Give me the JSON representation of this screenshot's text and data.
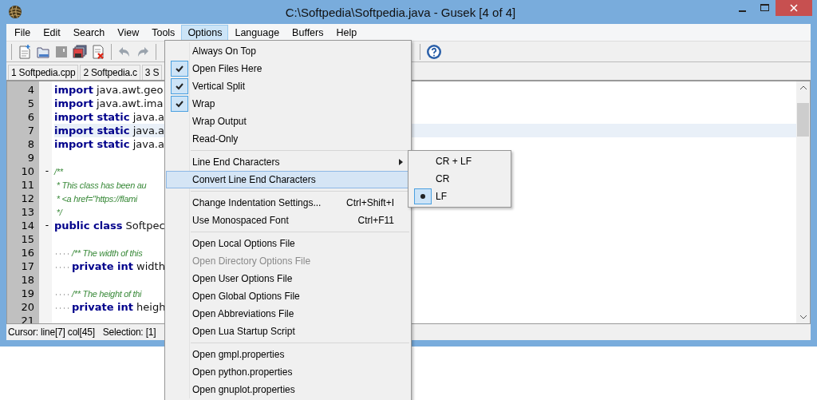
{
  "window": {
    "title": "C:\\Softpedia\\Softpedia.java - Gusek [4 of 4]"
  },
  "menubar": [
    {
      "label": "File",
      "selected": false
    },
    {
      "label": "Edit",
      "selected": false
    },
    {
      "label": "Search",
      "selected": false
    },
    {
      "label": "View",
      "selected": false
    },
    {
      "label": "Tools",
      "selected": false
    },
    {
      "label": "Options",
      "selected": true
    },
    {
      "label": "Language",
      "selected": false
    },
    {
      "label": "Buffers",
      "selected": false
    },
    {
      "label": "Help",
      "selected": false
    }
  ],
  "tabs": [
    {
      "label": "1 Softpedia.cpp",
      "selected": false
    },
    {
      "label": "2 Softpedia.c",
      "selected": false
    },
    {
      "label": "3 S",
      "selected": false
    }
  ],
  "editor": {
    "lines": [
      {
        "number": "4",
        "current": false,
        "tokens": [
          {
            "kind": "keyword",
            "text": "import"
          },
          {
            "kind": "plain",
            "text": " java.awt.geo"
          }
        ]
      },
      {
        "number": "5",
        "current": false,
        "tokens": [
          {
            "kind": "keyword",
            "text": "import"
          },
          {
            "kind": "plain",
            "text": " java.awt.ima"
          }
        ]
      },
      {
        "number": "6",
        "current": false,
        "tokens": [
          {
            "kind": "keyword",
            "text": "import static"
          },
          {
            "kind": "plain",
            "text": " java.a"
          }
        ]
      },
      {
        "number": "7",
        "current": true,
        "tokens": [
          {
            "kind": "keyword",
            "text": "import static"
          },
          {
            "kind": "plain",
            "text": " java.a"
          }
        ]
      },
      {
        "number": "8",
        "current": false,
        "tokens": [
          {
            "kind": "keyword",
            "text": "import static"
          },
          {
            "kind": "plain",
            "text": " java.a"
          }
        ]
      },
      {
        "number": "9",
        "current": false
      },
      {
        "number": "10",
        "fold": "-",
        "current": false,
        "tokens": [
          {
            "kind": "comment",
            "text": "/**"
          }
        ]
      },
      {
        "number": "11",
        "current": false,
        "tokens": [
          {
            "kind": "comment",
            "text": " * This class has been au"
          }
        ]
      },
      {
        "number": "12",
        "current": false,
        "tokens": [
          {
            "kind": "comment",
            "text": " * <a href=\"https://flami"
          }
        ]
      },
      {
        "number": "13",
        "current": false,
        "tokens": [
          {
            "kind": "comment",
            "text": " */"
          }
        ]
      },
      {
        "number": "14",
        "fold": "-",
        "current": false,
        "tokens": [
          {
            "kind": "keyword",
            "text": "public class"
          },
          {
            "kind": "plain",
            "text": " Softpec"
          }
        ]
      },
      {
        "number": "15",
        "current": false
      },
      {
        "number": "16",
        "current": false,
        "indented": true,
        "tokens": [
          {
            "kind": "comment",
            "text": "/** The width of this"
          }
        ]
      },
      {
        "number": "17",
        "current": false,
        "indented": true,
        "tokens": [
          {
            "kind": "keyword",
            "text": "private int"
          },
          {
            "kind": "plain",
            "text": " width"
          }
        ]
      },
      {
        "number": "18",
        "current": false
      },
      {
        "number": "19",
        "current": false,
        "indented": true,
        "tokens": [
          {
            "kind": "comment",
            "text": "/** The height of thi"
          }
        ]
      },
      {
        "number": "20",
        "current": false,
        "indented": true,
        "tokens": [
          {
            "kind": "keyword",
            "text": "private int"
          },
          {
            "kind": "plain",
            "text": " heigh"
          }
        ]
      },
      {
        "number": "21",
        "current": false
      }
    ]
  },
  "status_bar": {
    "cursor": "Cursor: line[7] col[45]",
    "selection": "Selection: [1]"
  },
  "options_menu": [
    {
      "kind": "item",
      "label": "Always On Top",
      "checked": false
    },
    {
      "kind": "item",
      "label": "Open Files Here",
      "checked": true
    },
    {
      "kind": "item",
      "label": "Vertical Split",
      "checked": true
    },
    {
      "kind": "item",
      "label": "Wrap",
      "checked": true
    },
    {
      "kind": "item",
      "label": "Wrap Output",
      "checked": false
    },
    {
      "kind": "item",
      "label": "Read-Only",
      "checked": false
    },
    {
      "kind": "separator"
    },
    {
      "kind": "submenu",
      "label": "Line End Characters"
    },
    {
      "kind": "item",
      "label": "Convert Line End Characters",
      "selected": true
    },
    {
      "kind": "separator"
    },
    {
      "kind": "item",
      "label": "Change Indentation Settings...",
      "shortcut": "Ctrl+Shift+I"
    },
    {
      "kind": "item",
      "label": "Use Monospaced Font",
      "shortcut": "Ctrl+F11"
    },
    {
      "kind": "separator"
    },
    {
      "kind": "item",
      "label": "Open Local Options File"
    },
    {
      "kind": "item",
      "label": "Open Directory Options File",
      "disabled": true
    },
    {
      "kind": "item",
      "label": "Open User Options File"
    },
    {
      "kind": "item",
      "label": "Open Global Options File"
    },
    {
      "kind": "item",
      "label": "Open Abbreviations File"
    },
    {
      "kind": "item",
      "label": "Open Lua Startup Script"
    },
    {
      "kind": "separator"
    },
    {
      "kind": "item",
      "label": "Open gmpl.properties"
    },
    {
      "kind": "item",
      "label": "Open python.properties"
    },
    {
      "kind": "item",
      "label": "Open gnuplot.properties"
    }
  ],
  "line_end_submenu": [
    {
      "label": "CR + LF",
      "selected": false
    },
    {
      "label": "CR",
      "selected": false
    },
    {
      "label": "LF",
      "selected": true
    }
  ]
}
